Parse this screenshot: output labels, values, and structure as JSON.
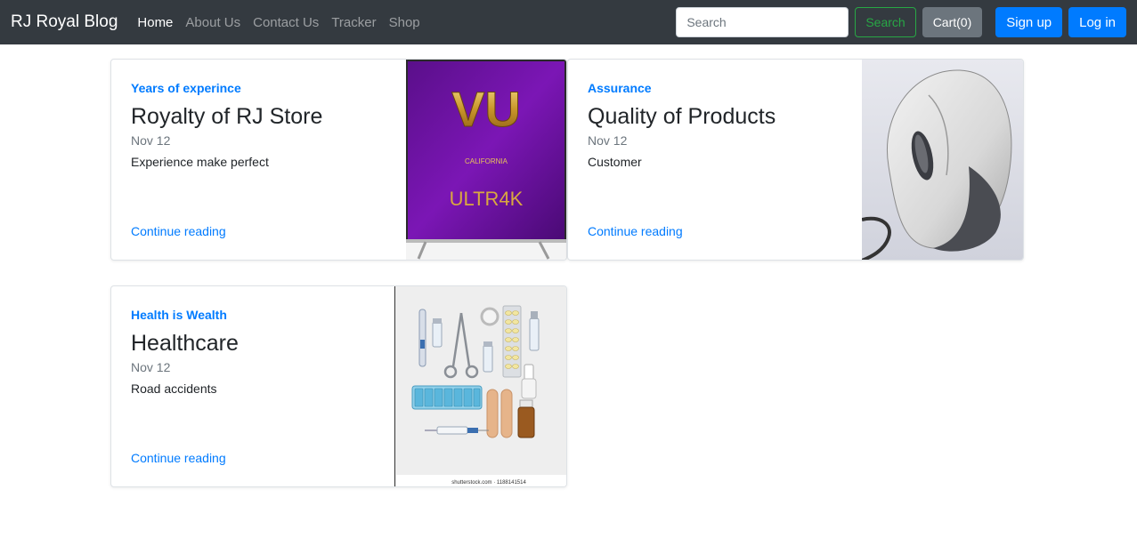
{
  "navbar": {
    "brand": "RJ Royal Blog",
    "links": [
      "Home",
      "About Us",
      "Contact Us",
      "Tracker",
      "Shop"
    ],
    "search_placeholder": "Search",
    "search_button": "Search",
    "cart_button": "Cart(0)",
    "signup_button": "Sign up",
    "login_button": "Log in"
  },
  "posts": [
    {
      "category": "Years of experince",
      "title": "Royalty of RJ Store",
      "date": "Nov 12",
      "excerpt": "Experience make perfect",
      "link": "Continue reading",
      "image": "tv-image",
      "image_text": {
        "brand": "VU",
        "region": "CALIFORNIA",
        "model": "ULTR4K"
      }
    },
    {
      "category": "Assurance",
      "title": "Quality of Products",
      "date": "Nov 12",
      "excerpt": "Customer",
      "link": "Continue reading",
      "image": "computer-mouse-image"
    },
    {
      "category": "Health is Wealth",
      "title": "Healthcare",
      "date": "Nov 12",
      "excerpt": "Road accidents",
      "link": "Continue reading",
      "image": "medical-supplies-image",
      "image_text": {
        "watermark": "shutterstock.com · 1188141514"
      }
    }
  ],
  "colors": {
    "navbar_bg": "#343a40",
    "primary": "#007bff",
    "success": "#28a745",
    "secondary": "#6c757d"
  }
}
